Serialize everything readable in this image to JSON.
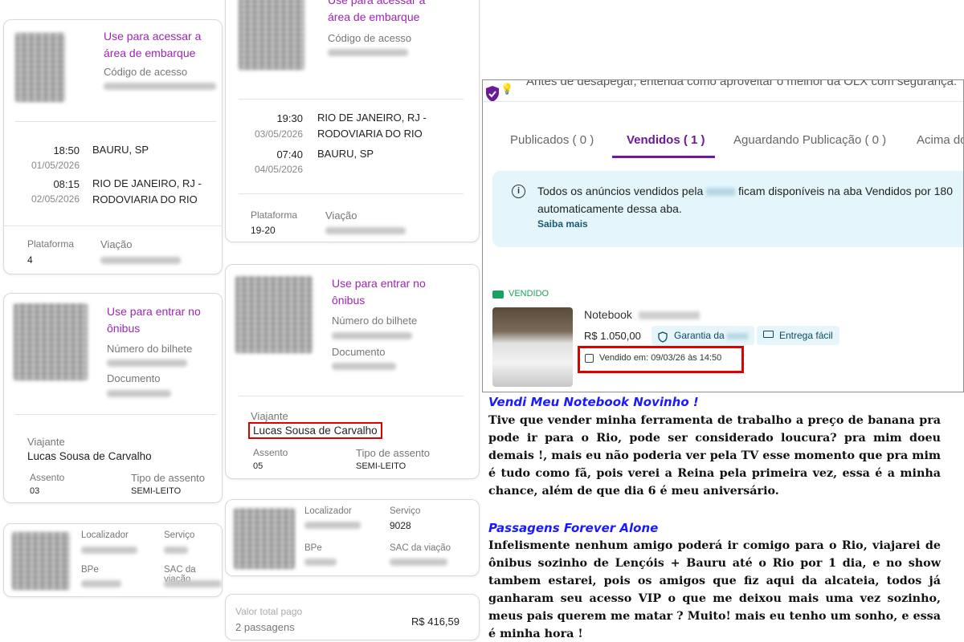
{
  "ticket_outbound": {
    "access_title": "Use para acessar a área de embarque",
    "access_code_label": "Código de acesso",
    "departure_time": "18:50",
    "departure_date": "01/05/2026",
    "departure_city": "BAURU, SP",
    "arrival_time": "08:15",
    "arrival_date": "02/05/2026",
    "arrival_city": "RIO DE JANEIRO, RJ - RODOVIARIA DO RIO",
    "platform_label": "Plataforma",
    "platform_value": "4",
    "company_label": "Viação"
  },
  "boarding_outbound": {
    "title": "Use para entrar no ônibus",
    "ticket_number_label": "Número do bilhete",
    "document_label": "Documento",
    "traveler_label": "Viajante",
    "traveler_name": "Lucas Sousa de Carvalho",
    "seat_label": "Assento",
    "seat_value": "03",
    "seat_type_label": "Tipo de assento",
    "seat_type_value": "SEMI-LEITO"
  },
  "summary_outbound": {
    "locator_label": "Localizador",
    "service_label": "Serviço",
    "bpe_label": "BPe",
    "sac_label": "SAC da viação"
  },
  "ticket_return": {
    "access_title": "Use para acessar a área de embarque",
    "access_code_label": "Código de acesso",
    "departure_time": "19:30",
    "departure_date": "03/05/2026",
    "departure_city": "RIO DE JANEIRO, RJ - RODOVIARIA DO RIO",
    "arrival_time": "07:40",
    "arrival_date": "04/05/2026",
    "arrival_city": "BAURU, SP",
    "platform_label": "Plataforma",
    "platform_value": "19-20",
    "company_label": "Viação"
  },
  "boarding_return": {
    "title": "Use para entrar no ônibus",
    "ticket_number_label": "Número do bilhete",
    "document_label": "Documento",
    "traveler_label": "Viajante",
    "traveler_name": "Lucas Sousa de Carvalho",
    "seat_label": "Assento",
    "seat_value": "05",
    "seat_type_label": "Tipo de assento",
    "seat_type_value": "SEMI-LEITO"
  },
  "summary_return": {
    "locator_label": "Localizador",
    "service_label": "Serviço",
    "service_value": "9028",
    "bpe_label": "BPe",
    "sac_label": "SAC da viação"
  },
  "total": {
    "label": "Valor total pago",
    "count": "2 passagens",
    "amount": "R$ 416,59"
  },
  "olx": {
    "banner_text": "Antes de desapegar, entenda como aproveitar o melhor da OLX com segurança.",
    "tabs": [
      {
        "label": "Publicados ( 0 )"
      },
      {
        "label": "Vendidos ( 1 )"
      },
      {
        "label": "Aguardando Publicação ( 0 )"
      },
      {
        "label": "Acima do"
      }
    ],
    "info_prefix": "Todos os anúncios vendidos pela",
    "info_suffix": "ficam disponíveis na aba Vendidos por 180",
    "info_line2": "automaticamente dessa aba.",
    "info_link": "Saiba mais",
    "sold_badge": "VENDIDO",
    "listing_title": "Notebook",
    "listing_price": "R$ 1.050,00",
    "guarantee_chip": "Garantia da",
    "delivery_chip": "Entrega fácil",
    "sold_date": "Vendido em: 09/03/26 às 14:50",
    "colors": {
      "accent": "#6a1b9a",
      "badge_green": "#1aa260",
      "info_bg": "#e4f6fb",
      "highlight_red": "#e00000"
    }
  },
  "blog": {
    "heading1": "Vendi Meu Notebook Novinho !",
    "para1": "Tive que vender minha ferramenta de trabalho a preço de banana pra pode ir para o Rio, pode ser considerado loucura? pra mim doeu demais !, mais eu não poderia ver pela TV esse momento que pra mim é tudo como fã, pois verei a Reina pela primeira vez, essa é a minha chance, além de que dia 6 é meu aniversário.",
    "heading2": "Passagens Forever Alone",
    "para2": "Infelismente nenhum amigo poderá ir comigo para o Rio, viajarei de ônibus sozinho de Lençóis + Bauru até o Rio por 1 dia, e no show tambem estarei, pois os amigos que fiz aqui da alcateia, todos já ganharam seu acesso VIP o que me deixou mais uma vez sozinho, meus pais querem me matar ? Muito! mais eu tenho um sonho, e essa é minha hora !"
  }
}
